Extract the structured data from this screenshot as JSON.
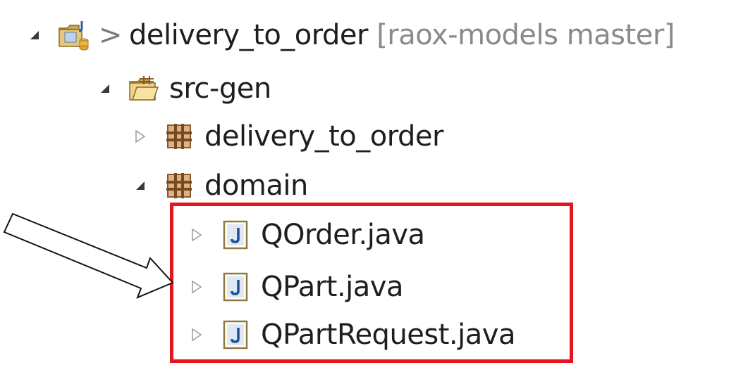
{
  "tree": {
    "project": {
      "prefix": ">",
      "name": "delivery_to_order",
      "decoration": "[raox-models master]"
    },
    "source_folder": {
      "name": "src-gen"
    },
    "packages": [
      {
        "name": "delivery_to_order",
        "expanded": false
      },
      {
        "name": "domain",
        "expanded": true
      }
    ],
    "files": [
      {
        "name": "QOrder.java"
      },
      {
        "name": "QPart.java"
      },
      {
        "name": "QPartRequest.java"
      }
    ]
  },
  "colors": {
    "highlight_border": "#e8141d",
    "decoration_text": "#8a8a8a",
    "package_icon": "#8b5a2b",
    "java_icon": "#3e6fb0"
  },
  "icons": {
    "expanded": "expanded-triangle-icon",
    "collapsed": "collapsed-triangle-icon",
    "project": "project-folder-icon",
    "source_folder": "source-folder-icon",
    "package": "package-icon",
    "java_file": "java-file-icon",
    "annotation": "callout-arrow"
  }
}
